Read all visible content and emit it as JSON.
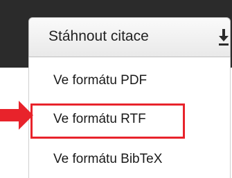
{
  "colors": {
    "topbar": "#2b2b2b",
    "highlight": "#e8232b",
    "arrow": "#e8232b",
    "text": "#222222"
  },
  "download_button": {
    "label": "Stáhnout citace",
    "icon": "download-icon"
  },
  "menu": {
    "items": [
      {
        "label": "Ve formátu PDF"
      },
      {
        "label": "Ve formátu RTF",
        "highlighted": true
      },
      {
        "label": "Ve formátu BibTeX"
      }
    ]
  },
  "annotation": {
    "arrow_icon": "red-arrow-right-icon",
    "highlight_target": "Ve formátu RTF"
  }
}
